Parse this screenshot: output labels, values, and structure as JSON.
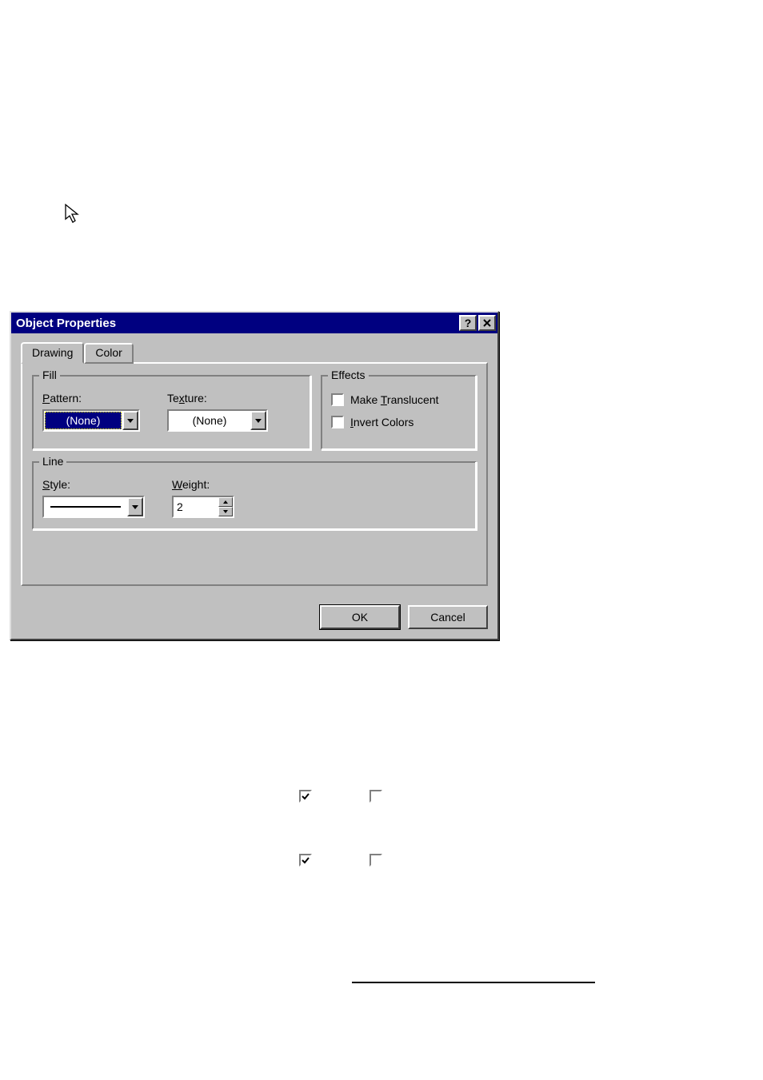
{
  "dialog": {
    "title": "Object Properties",
    "tabs": {
      "drawing": "Drawing",
      "color": "Color"
    },
    "fill": {
      "legend": "Fill",
      "pattern": {
        "label_pre": "P",
        "label_post": "attern:",
        "value": "(None)"
      },
      "texture": {
        "label_pre": "Te",
        "label_u": "x",
        "label_post": "ture:",
        "value": "(None)"
      }
    },
    "effects": {
      "legend": "Effects",
      "translucent": {
        "pre": "Make ",
        "u": "T",
        "post": "ranslucent"
      },
      "invert": {
        "u": "I",
        "post": "nvert Colors"
      }
    },
    "line": {
      "legend": "Line",
      "style": {
        "u": "S",
        "post": "tyle:"
      },
      "weight": {
        "u": "W",
        "post": "eight:",
        "value": "2"
      }
    },
    "buttons": {
      "ok": "OK",
      "cancel": "Cancel"
    }
  }
}
